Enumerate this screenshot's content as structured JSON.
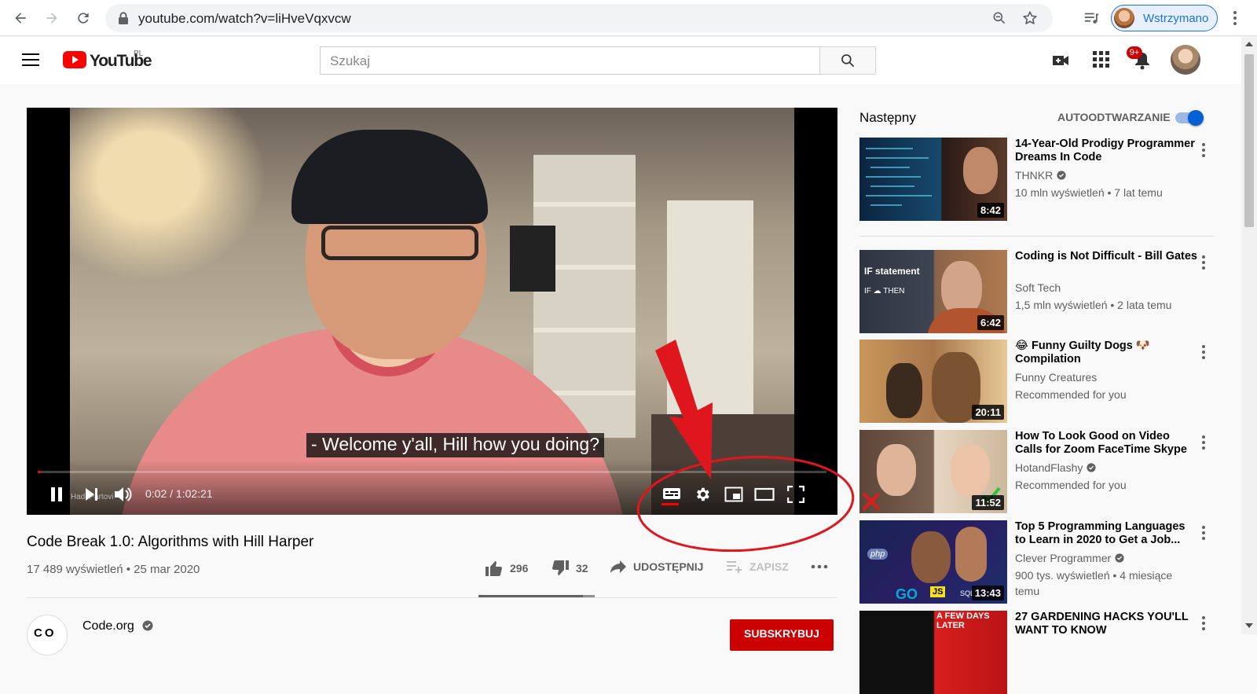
{
  "browser": {
    "url": "youtube.com/watch?v=liHveVqxvcw",
    "paused_label": "Wstrzymano"
  },
  "youtube": {
    "logo_text": "YouTube",
    "country_code": "PL",
    "search_placeholder": "Szukaj",
    "notifications_badge": "9+"
  },
  "player": {
    "caption": "- Welcome y'all, Hill how you doing?",
    "speaker_tag": "Hadi Partovi",
    "time": "0:02 / 1:02:21",
    "progress_fraction": 0.0005
  },
  "video": {
    "title": "Code Break 1.0: Algorithms with Hill Harper",
    "meta": "17 489 wyświetleń • 25 mar 2020",
    "likes": "296",
    "dislikes": "32",
    "share_label": "UDOSTĘPNIJ",
    "save_label": "ZAPISZ",
    "like_fraction": 0.902,
    "channel": {
      "avatar_text": "CO",
      "name": "Code.org",
      "subscribe_label": "SUBSKRYBUJ"
    }
  },
  "sidebar": {
    "next_label": "Następny",
    "autoplay_label": "AUTOODTWARZANIE",
    "autoplay_on": true,
    "cards": [
      {
        "title": "14-Year-Old Prodigy Programmer Dreams In Code",
        "channel": "THNKR",
        "verified": true,
        "stats": "10 mln wyświetleń • 7 lat temu",
        "duration": "8:42",
        "thumb_colors": [
          "#0f2a44",
          "#1b5e85"
        ]
      },
      {
        "title": "Coding is Not Difficult - Bill Gates",
        "channel": "Soft Tech",
        "verified": false,
        "stats": "1,5 mln wyświetleń • 2 lata temu",
        "duration": "6:42",
        "thumb_text_1": "IF statement",
        "thumb_text_2": "IF ☁ THEN",
        "thumb_colors": [
          "#3a3f4a",
          "#7a5a3c"
        ]
      },
      {
        "title": "😂 Funny Guilty Dogs 🐶 Compilation",
        "channel": "Funny Creatures",
        "verified": false,
        "stats": "Recommended for you",
        "duration": "20:11",
        "thumb_colors": [
          "#b98c57",
          "#e2c08a"
        ]
      },
      {
        "title": "How To Look Good on Video Calls for Zoom FaceTime Skype",
        "channel": "HotandFlashy",
        "verified": true,
        "stats": "Recommended for you",
        "duration": "11:52",
        "thumb_colors": [
          "#6b5548",
          "#d9c3a8"
        ]
      },
      {
        "title": "Top 5 Programming Languages to Learn in 2020 to Get a Job...",
        "channel": "Clever Programmer",
        "verified": true,
        "stats": "900 tys. wyświetleń • 4 miesiące temu",
        "duration": "13:43",
        "thumb_text_1": "php",
        "thumb_text_2": "GO",
        "thumb_text_3": "JS",
        "thumb_text_4": "SQL",
        "thumb_colors": [
          "#1b2a5a",
          "#3b1f6b"
        ]
      },
      {
        "title": "27 GARDENING HACKS YOU'LL WANT TO KNOW",
        "thumb_text_1": "A FEW DAYS LATER",
        "thumb_colors": [
          "#111111",
          "#cc0000"
        ]
      }
    ]
  },
  "colors": {
    "youtube_red": "#ff0000",
    "subscribe_red": "#cc0000",
    "annotation_red": "#e0161f",
    "link_blue": "#1a73e8",
    "toggle_blue": "#065fd4"
  }
}
